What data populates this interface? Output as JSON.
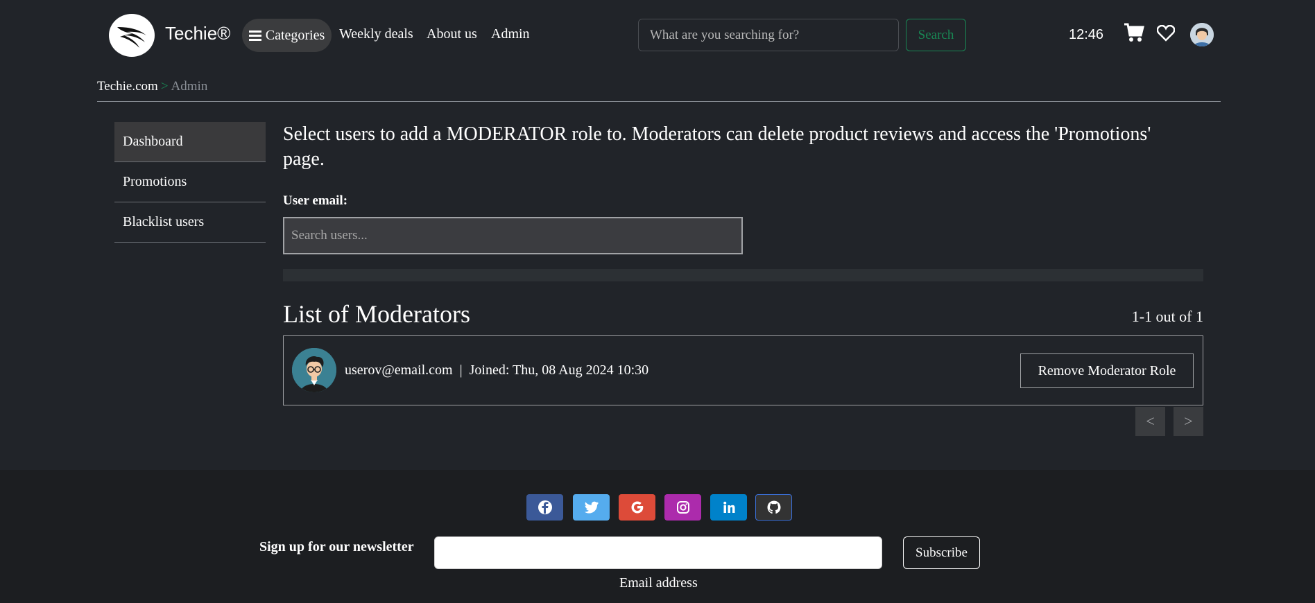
{
  "header": {
    "brand": "Techie®",
    "nav": {
      "categories": "Categories",
      "weekly_deals": "Weekly deals",
      "about_us": "About us",
      "admin": "Admin"
    },
    "search": {
      "placeholder": "What are you searching for?",
      "button": "Search"
    },
    "clock": "12:46",
    "icons": [
      "cart-icon",
      "heart-icon",
      "user-avatar"
    ]
  },
  "breadcrumb": {
    "home": "Techie.com",
    "separator": ">",
    "current": "Admin"
  },
  "sidebar": {
    "items": [
      {
        "label": "Dashboard",
        "active": true
      },
      {
        "label": "Promotions",
        "active": false
      },
      {
        "label": "Blacklist users",
        "active": false
      }
    ]
  },
  "main": {
    "intro": "Select users to add a MODERATOR role to. Moderators can delete product reviews and access the 'Promotions' page.",
    "user_email_label": "User email:",
    "user_search_placeholder": "Search users...",
    "list_title": "List of Moderators",
    "list_count": "1-1 out of 1",
    "moderators": [
      {
        "email": "userov@email.com",
        "separator": "|",
        "joined": "Joined: Thu, 08 Aug 2024 10:30",
        "action": "Remove Moderator Role"
      }
    ],
    "pagination": {
      "prev": "<",
      "next": ">"
    }
  },
  "footer": {
    "social": [
      {
        "name": "facebook-icon",
        "color": "#3b5998"
      },
      {
        "name": "twitter-icon",
        "color": "#55acee"
      },
      {
        "name": "google-icon",
        "color": "#dd4b39"
      },
      {
        "name": "instagram-icon",
        "color": "#ac2bac"
      },
      {
        "name": "linkedin-icon",
        "color": "#0082ca"
      },
      {
        "name": "github-icon",
        "color": "#333333"
      }
    ],
    "newsletter_label": "Sign up for our newsletter",
    "email_caption": "Email address",
    "subscribe": "Subscribe"
  },
  "colors": {
    "accent": "#198754",
    "background": "#212429",
    "footer": "#1c1e21"
  }
}
